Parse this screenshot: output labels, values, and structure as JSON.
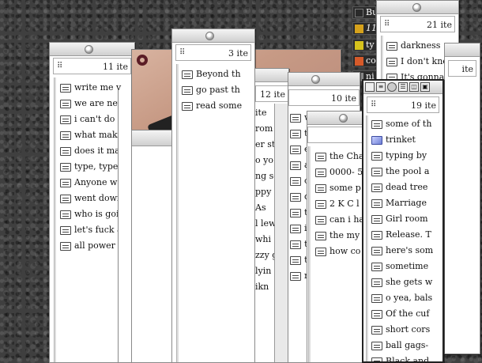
{
  "desktop_items": [
    {
      "label": "Bu",
      "icon": "desktop-icon",
      "color": "#2a2a2a"
    },
    {
      "label": "11",
      "icon": "note-icon",
      "color": "#d6a21c"
    },
    {
      "label": "ty",
      "icon": "folder-icon",
      "color": "#d6c21c"
    },
    {
      "label": "co",
      "icon": "image-icon",
      "color": "#d65a2a"
    },
    {
      "label": "ni",
      "icon": "doc-icon",
      "color": "#888888"
    }
  ],
  "win_a": {
    "count": "11 ite",
    "items": [
      "write me v",
      "we are nev",
      "i can't do a",
      "what mak",
      "does it ma",
      "type, type",
      "Anyone wa",
      "went dowr",
      "who is goi",
      "let's fuck a",
      "all power"
    ]
  },
  "win_b": {
    "count": "3 ite",
    "items": [
      "Beyond th",
      "go past th",
      "read some"
    ]
  },
  "win_c": {
    "count": "12 ite",
    "items": [
      "ite",
      "rom",
      "er st",
      "o yo",
      "ng se",
      "ppy",
      "As",
      "l lew",
      "whi",
      "zzy g",
      "lyin",
      "ikn"
    ]
  },
  "win_d": {
    "count": "10 ite",
    "items": [
      "w",
      "t",
      "e",
      "a",
      "c",
      "d",
      "t",
      "i",
      "t",
      "t",
      "r"
    ]
  },
  "win_e": {
    "count": "",
    "items": [
      "the Cha",
      "0000- 5",
      "some p",
      "2 K C l",
      "can i ha",
      "the my",
      "how co"
    ]
  },
  "win_f": {
    "count": "21 ite",
    "items": [
      "darkness",
      "I don't kno",
      "It's gonna"
    ]
  },
  "win_g": {
    "count": "19 ite",
    "items": [
      {
        "label": "some of th",
        "icon": "note-icon"
      },
      {
        "label": "trinket",
        "icon": "cube-icon"
      },
      {
        "label": "typing by",
        "icon": "note-icon"
      },
      {
        "label": "the pool a",
        "icon": "note-icon"
      },
      {
        "label": "dead tree",
        "icon": "note-icon"
      },
      {
        "label": "Marriage",
        "icon": "note-icon"
      },
      {
        "label": "Girl room",
        "icon": "note-icon"
      },
      {
        "label": "Release. T",
        "icon": "note-icon"
      },
      {
        "label": "here's som",
        "icon": "note-icon"
      },
      {
        "label": "sometime",
        "icon": "note-icon"
      },
      {
        "label": "she gets w",
        "icon": "note-icon"
      },
      {
        "label": "o yea, bals",
        "icon": "note-icon"
      },
      {
        "label": "Of the cuf",
        "icon": "note-icon"
      },
      {
        "label": "short cors",
        "icon": "note-icon"
      },
      {
        "label": "ball gags-",
        "icon": "note-icon"
      },
      {
        "label": "Black and",
        "icon": "note-icon"
      }
    ]
  },
  "win_h": {
    "count": "ite"
  },
  "toolbar_icons": [
    "close-box-icon",
    "list-view-icon",
    "round-icon",
    "detail-view-icon",
    "split-view-icon",
    "zoom-box-icon"
  ]
}
